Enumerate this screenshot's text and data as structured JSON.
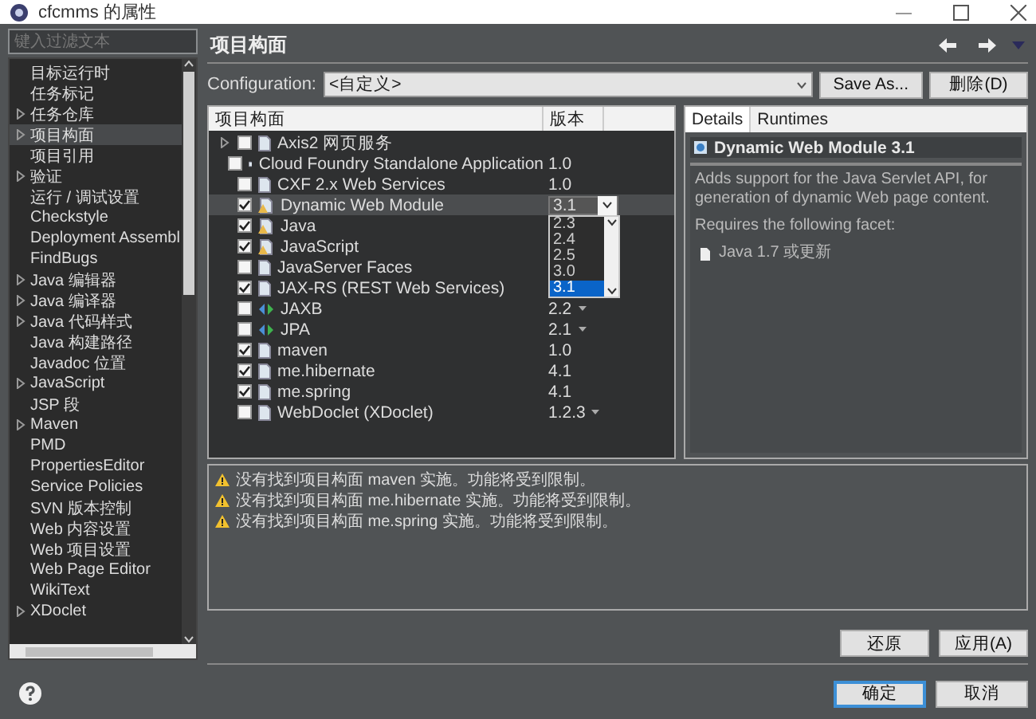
{
  "window": {
    "title": "cfcmms 的属性"
  },
  "sidebar": {
    "filter": {
      "placeholder": "键入过滤文本"
    },
    "items": [
      {
        "label": "目标运行时",
        "expandable": false,
        "selected": false
      },
      {
        "label": "任务标记",
        "expandable": false,
        "selected": false
      },
      {
        "label": "任务仓库",
        "expandable": true,
        "selected": false
      },
      {
        "label": "项目构面",
        "expandable": true,
        "selected": true
      },
      {
        "label": "项目引用",
        "expandable": false,
        "selected": false
      },
      {
        "label": "验证",
        "expandable": true,
        "selected": false
      },
      {
        "label": "运行 / 调试设置",
        "expandable": false,
        "selected": false
      },
      {
        "label": "Checkstyle",
        "expandable": false,
        "selected": false
      },
      {
        "label": "Deployment Assembl",
        "expandable": false,
        "selected": false
      },
      {
        "label": "FindBugs",
        "expandable": false,
        "selected": false
      },
      {
        "label": "Java 编辑器",
        "expandable": true,
        "selected": false
      },
      {
        "label": "Java 编译器",
        "expandable": true,
        "selected": false
      },
      {
        "label": "Java 代码样式",
        "expandable": true,
        "selected": false
      },
      {
        "label": "Java 构建路径",
        "expandable": false,
        "selected": false
      },
      {
        "label": "Javadoc 位置",
        "expandable": false,
        "selected": false
      },
      {
        "label": "JavaScript",
        "expandable": true,
        "selected": false
      },
      {
        "label": "JSP 段",
        "expandable": false,
        "selected": false
      },
      {
        "label": "Maven",
        "expandable": true,
        "selected": false
      },
      {
        "label": "PMD",
        "expandable": false,
        "selected": false
      },
      {
        "label": "PropertiesEditor",
        "expandable": false,
        "selected": false
      },
      {
        "label": "Service Policies",
        "expandable": false,
        "selected": false
      },
      {
        "label": "SVN 版本控制",
        "expandable": false,
        "selected": false
      },
      {
        "label": "Web 内容设置",
        "expandable": false,
        "selected": false
      },
      {
        "label": "Web 项目设置",
        "expandable": false,
        "selected": false
      },
      {
        "label": "Web Page Editor",
        "expandable": false,
        "selected": false
      },
      {
        "label": "WikiText",
        "expandable": false,
        "selected": false
      },
      {
        "label": "XDoclet",
        "expandable": true,
        "selected": false
      }
    ]
  },
  "page": {
    "title": "项目构面"
  },
  "configuration": {
    "label": "Configuration:",
    "value": "<自定义>",
    "buttons": [
      "Save As...",
      "删除(D)"
    ]
  },
  "facets": {
    "columns": [
      "项目构面",
      "版本"
    ],
    "rows": [
      {
        "name": "Axis2 网页服务",
        "version": "",
        "checked": false,
        "expandable": true,
        "kind": "page",
        "menu": false,
        "selected": false
      },
      {
        "name": "Cloud Foundry Standalone Application",
        "version": "1.0",
        "checked": false,
        "expandable": false,
        "kind": "page",
        "menu": false,
        "selected": false
      },
      {
        "name": "CXF 2.x Web Services",
        "version": "1.0",
        "checked": false,
        "expandable": false,
        "kind": "page",
        "menu": false,
        "selected": false
      },
      {
        "name": "Dynamic Web Module",
        "version": "3.1",
        "checked": true,
        "expandable": false,
        "kind": "module",
        "menu": true,
        "selected": true
      },
      {
        "name": "Java",
        "version": "",
        "checked": true,
        "expandable": false,
        "kind": "module",
        "menu": false,
        "selected": false
      },
      {
        "name": "JavaScript",
        "version": "",
        "checked": true,
        "expandable": false,
        "kind": "module",
        "menu": false,
        "selected": false
      },
      {
        "name": "JavaServer Faces",
        "version": "",
        "checked": false,
        "expandable": false,
        "kind": "page",
        "selected": false
      },
      {
        "name": "JAX-RS (REST Web Services)",
        "version": "",
        "checked": true,
        "expandable": false,
        "kind": "page",
        "menu": false,
        "selected": false
      },
      {
        "name": "JAXB",
        "version": "2.2",
        "checked": false,
        "expandable": false,
        "kind": "connector",
        "menu": true,
        "selected": false
      },
      {
        "name": "JPA",
        "version": "2.1",
        "checked": false,
        "expandable": false,
        "kind": "connector",
        "menu": true,
        "selected": false
      },
      {
        "name": "maven",
        "version": "1.0",
        "checked": true,
        "expandable": false,
        "kind": "page",
        "menu": false,
        "selected": false
      },
      {
        "name": "me.hibernate",
        "version": "4.1",
        "checked": true,
        "expandable": false,
        "kind": "page",
        "menu": false,
        "selected": false
      },
      {
        "name": "me.spring",
        "version": "4.1",
        "checked": true,
        "expandable": false,
        "kind": "page",
        "menu": false,
        "selected": false
      },
      {
        "name": "WebDoclet (XDoclet)",
        "version": "1.2.3",
        "checked": false,
        "expandable": false,
        "kind": "page",
        "menu": true,
        "selected": false
      }
    ],
    "dropdown": {
      "options": [
        {
          "label": "2.3",
          "selected": false
        },
        {
          "label": "2.4",
          "selected": false
        },
        {
          "label": "2.5",
          "selected": false
        },
        {
          "label": "3.0",
          "selected": false
        },
        {
          "label": "3.1",
          "selected": true
        }
      ]
    }
  },
  "details": {
    "tabs": [
      {
        "label": "Details",
        "selected": true
      },
      {
        "label": "Runtimes",
        "selected": false
      }
    ],
    "title": "Dynamic Web Module 3.1",
    "description": "Adds support for the Java Servlet API, for generation of dynamic Web page content.",
    "requires_label": "Requires the following facet:",
    "requirements": [
      "Java 1.7 或更新"
    ]
  },
  "messages": [
    "没有找到项目构面 maven 实施。功能将受到限制。",
    "没有找到项目构面 me.hibernate 实施。功能将受到限制。",
    "没有找到项目构面 me.spring 实施。功能将受到限制。"
  ],
  "actions": [
    "还原",
    "应用(A)"
  ],
  "footer": {
    "buttons": [
      {
        "label": "确定",
        "default": true
      },
      {
        "label": "取消",
        "default": false
      }
    ]
  }
}
